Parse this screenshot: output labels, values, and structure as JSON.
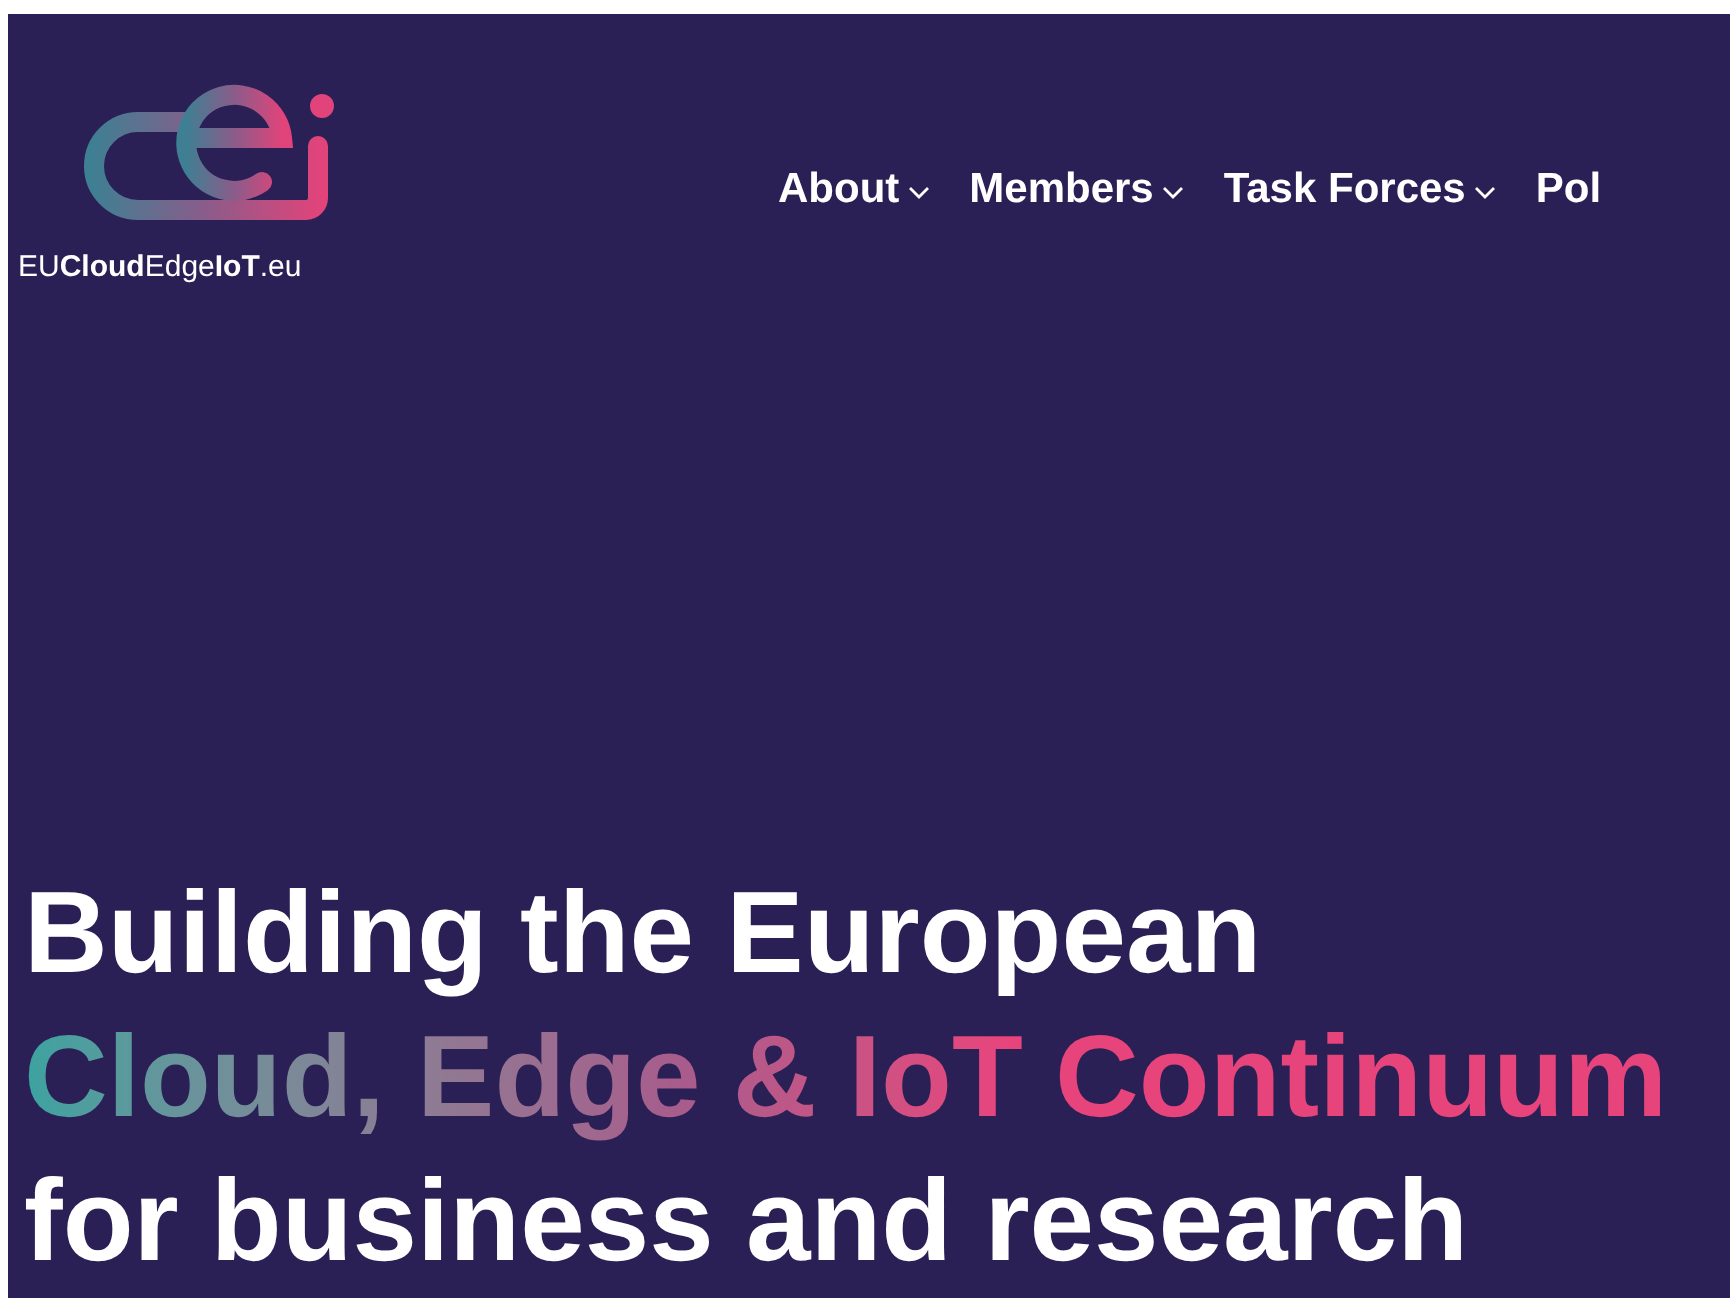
{
  "logo": {
    "wordmark": "EU**Cloud**Edge**IoT**.eu"
  },
  "nav": [
    {
      "label": "About",
      "has_menu": true
    },
    {
      "label": "Members",
      "has_menu": true
    },
    {
      "label": "Task Forces",
      "has_menu": true
    },
    {
      "label": "Pol",
      "has_menu": false
    }
  ],
  "hero": {
    "line_1": "Building the European",
    "line_2": "Cloud, Edge & IoT Continuum",
    "line_3": "for business and research"
  }
}
